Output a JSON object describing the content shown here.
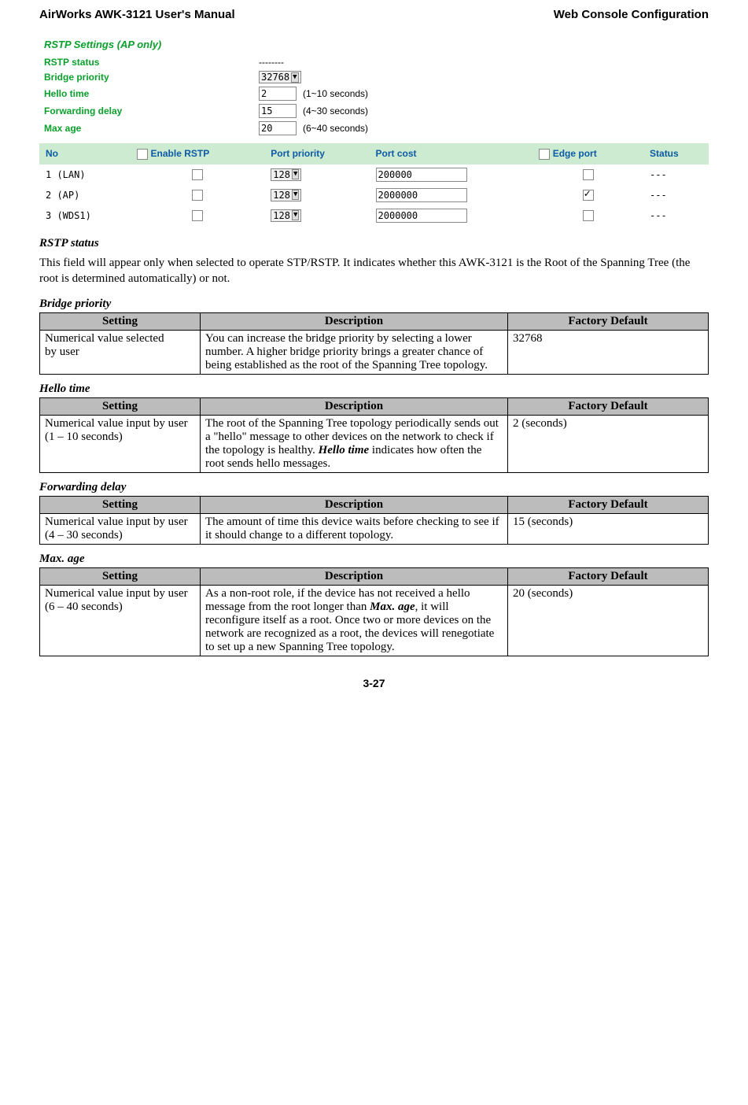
{
  "header": {
    "left": "AirWorks AWK-3121 User's Manual",
    "right": "Web Console Configuration"
  },
  "screenshot": {
    "title": "RSTP Settings (AP only)",
    "kv": [
      {
        "key": "RSTP status",
        "type": "text",
        "value": "--------"
      },
      {
        "key": "Bridge priority",
        "type": "drop",
        "value": "32768"
      },
      {
        "key": "Hello time",
        "type": "input",
        "value": "2",
        "hint": "(1~10 seconds)"
      },
      {
        "key": "Forwarding delay",
        "type": "input",
        "value": "15",
        "hint": "(4~30 seconds)"
      },
      {
        "key": "Max age",
        "type": "input",
        "value": "20",
        "hint": "(6~40 seconds)"
      }
    ],
    "table": {
      "headers": [
        "No",
        "Enable RSTP",
        "Port priority",
        "Port cost",
        "Edge port",
        "Status"
      ],
      "rows": [
        {
          "no": "1",
          "name": "(LAN)",
          "enable": false,
          "priority": "128",
          "cost": "200000",
          "edge": false,
          "status": "---"
        },
        {
          "no": "2",
          "name": "(AP)",
          "enable": false,
          "priority": "128",
          "cost": "2000000",
          "edge": true,
          "status": "---"
        },
        {
          "no": "3",
          "name": "(WDS1)",
          "enable": false,
          "priority": "128",
          "cost": "2000000",
          "edge": false,
          "status": "---"
        }
      ]
    }
  },
  "sections": [
    {
      "title": "RSTP status",
      "paragraph": "This field will appear only when selected to operate STP/RSTP. It indicates whether this AWK-3121 is the Root of the Spanning Tree (the root is determined automatically) or not."
    }
  ],
  "tables": [
    {
      "title": "Bridge priority",
      "headers": [
        "Setting",
        "Description",
        "Factory Default"
      ],
      "row": {
        "setting_lines": [
          "Numerical value selected",
          "by user"
        ],
        "description": "You can increase the bridge priority by selecting a lower number. A higher bridge priority brings a greater chance of being established as the root of the Spanning Tree topology.",
        "default": "32768"
      }
    },
    {
      "title": "Hello time",
      "headers": [
        "Setting",
        "Description",
        "Factory Default"
      ],
      "row": {
        "setting_lines": [
          "Numerical value input by user",
          "(1 – 10 seconds)"
        ],
        "description_prefix": "The root of the Spanning Tree topology periodically sends out a \"hello\" message to other devices on the network to check if the topology is healthy. ",
        "emph": "Hello time",
        "description_suffix": " indicates how often the root sends hello messages.",
        "default": "2 (seconds)"
      }
    },
    {
      "title": "Forwarding delay",
      "headers": [
        "Setting",
        "Description",
        "Factory Default"
      ],
      "row": {
        "setting_lines": [
          "Numerical value input by user",
          "(4 – 30 seconds)"
        ],
        "description": "The amount of time this device waits before checking to see if it should change to a different topology.",
        "default": "15 (seconds)"
      }
    },
    {
      "title": "Max. age",
      "headers": [
        "Setting",
        "Description",
        "Factory Default"
      ],
      "row": {
        "setting_lines": [
          "Numerical value input by user",
          "(6 – 40 seconds)"
        ],
        "description_prefix": "As a non-root role, if the device has not received a hello message from the root longer than ",
        "emph": "Max. age",
        "description_suffix": ", it will reconfigure itself as a root. Once two or more devices on the network are recognized as a root, the devices will renegotiate to set up a new Spanning Tree topology.",
        "default": "20 (seconds)"
      }
    }
  ],
  "page_number": "3-27"
}
